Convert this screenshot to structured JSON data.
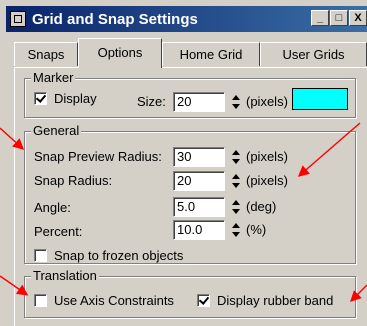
{
  "window": {
    "title": "Grid and Snap Settings",
    "buttons": {
      "minimize": "_",
      "maximize": "□",
      "close": "X"
    }
  },
  "tabs": [
    {
      "label": "Snaps",
      "active": false
    },
    {
      "label": "Options",
      "active": true
    },
    {
      "label": "Home Grid",
      "active": false
    },
    {
      "label": "User Grids",
      "active": false
    }
  ],
  "marker": {
    "group_label": "Marker",
    "display_label": "Display",
    "display_checked": true,
    "size_label": "Size:",
    "size_value": "20",
    "size_unit": "(pixels)",
    "color": "#00ffff"
  },
  "general": {
    "group_label": "General",
    "snap_preview_radius_label": "Snap Preview Radius:",
    "snap_preview_radius_value": "30",
    "snap_preview_radius_unit": "(pixels)",
    "snap_radius_label": "Snap Radius:",
    "snap_radius_value": "20",
    "snap_radius_unit": "(pixels)",
    "angle_label": "Angle:",
    "angle_value": "5.0",
    "angle_unit": "(deg)",
    "percent_label": "Percent:",
    "percent_value": "10.0",
    "percent_unit": "(%)",
    "snap_frozen_label": "Snap to frozen objects",
    "snap_frozen_checked": false
  },
  "translation": {
    "group_label": "Translation",
    "use_axis_label": "Use Axis Constraints",
    "use_axis_checked": false,
    "rubber_band_label": "Display rubber band",
    "rubber_band_checked": true
  },
  "colors": {
    "titlebar_start": "#0a246a",
    "titlebar_end": "#3a6ea5",
    "face": "#d4d0c8",
    "annotation_arrow": "#ff0000"
  }
}
